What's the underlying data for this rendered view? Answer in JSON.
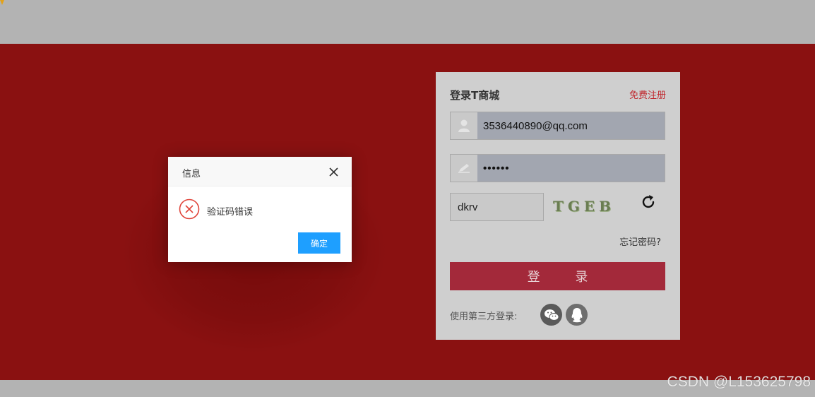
{
  "login": {
    "title": "登录T商城",
    "register_link": "免费注册",
    "username_value": "3536440890@qq.com",
    "password_value": "••••••",
    "captcha_value": "dkrv",
    "captcha_image_text": "TGEB",
    "forgot_link": "忘记密码?",
    "submit_label": "登 录",
    "third_party_label": "使用第三方登录:",
    "third_party_icons": [
      "wechat-icon",
      "qq-icon"
    ]
  },
  "dialog": {
    "title": "信息",
    "message": "验证码错误",
    "ok_label": "确定",
    "icon": "error-icon"
  },
  "watermark": "CSDN @L153625798",
  "colors": {
    "banner": "#8a1111",
    "page_bg": "#b3b3b3",
    "panel_bg": "#cfcfcf",
    "login_button": "#a3293a",
    "dialog_button": "#1e9fff",
    "error": "#e0443a",
    "register_link": "#c0282e"
  }
}
